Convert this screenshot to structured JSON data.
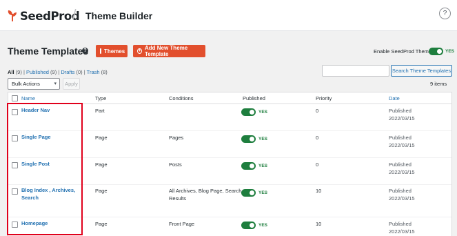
{
  "brand": {
    "name": "SeedProd",
    "logo_icon": "seedling-leaf-icon",
    "brand_color": "#e24f2d"
  },
  "header": {
    "title": "Theme Builder",
    "help_icon": "question-circle-icon",
    "help_glyph": "?"
  },
  "page": {
    "title": "Theme Templates",
    "title_help_glyph": "?",
    "themes_button": "Themes",
    "add_button": "Add New Theme Template",
    "enable_label": "Enable SeedProd Theme",
    "enable_state": "YES"
  },
  "filters": {
    "all": "All",
    "all_count": "(9)",
    "published": "Published",
    "published_count": "(9)",
    "drafts": "Drafts",
    "drafts_count": "(0)",
    "trash": "Trash",
    "trash_count": "(8)",
    "separator": "|"
  },
  "search": {
    "placeholder": "",
    "button": "Search Theme Templates"
  },
  "bulk": {
    "label": "Bulk Actions",
    "apply": "Apply",
    "items_count": "9 items"
  },
  "table": {
    "columns": {
      "name": "Name",
      "type": "Type",
      "conditions": "Conditions",
      "published": "Published",
      "priority": "Priority",
      "date": "Date"
    },
    "rows": [
      {
        "name": "Header Nav",
        "type": "Part",
        "conditions": "",
        "published": "YES",
        "priority": "0",
        "date_status": "Published",
        "date": "2022/03/15"
      },
      {
        "name": "Single Page",
        "type": "Page",
        "conditions": "Pages",
        "published": "YES",
        "priority": "0",
        "date_status": "Published",
        "date": "2022/03/15"
      },
      {
        "name": "Single Post",
        "type": "Page",
        "conditions": "Posts",
        "published": "YES",
        "priority": "0",
        "date_status": "Published",
        "date": "2022/03/15"
      },
      {
        "name_line1": "Blog Index , Archives,",
        "name_line2": "Search",
        "type": "Page",
        "conditions_line1": "All Archives, Blog Page, Search",
        "conditions_line2": "Results",
        "published": "YES",
        "priority": "10",
        "date_status": "Published",
        "date": "2022/03/15"
      },
      {
        "name": "Homepage",
        "type": "Page",
        "conditions": "Front Page",
        "published": "YES",
        "priority": "10",
        "date_status": "Published",
        "date": "2022/03/15"
      }
    ]
  },
  "colors": {
    "toggle_on": "#1e7e3e",
    "link": "#2271b1",
    "highlight_box": "#e0001b"
  }
}
